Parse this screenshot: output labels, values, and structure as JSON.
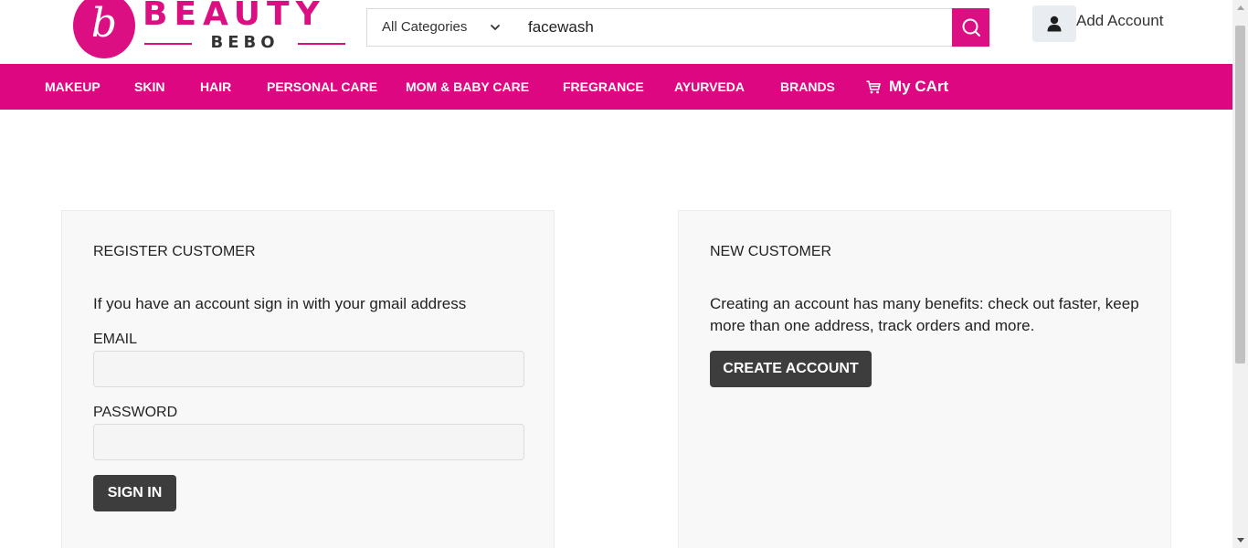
{
  "logo": {
    "initial": "b",
    "word": "BEAUTY",
    "sub": "BEBO"
  },
  "search": {
    "category": "All Categories",
    "query": "facewash"
  },
  "account": {
    "label": "Add Account"
  },
  "nav": {
    "items": [
      "MAKEUP",
      "SKIN",
      "HAIR",
      "PERSONAL CARE",
      "MOM & BABY CARE",
      "FREGRANCE",
      "AYURVEDA",
      "BRANDS"
    ],
    "cart_label": "My CArt"
  },
  "register": {
    "title": "REGISTER CUSTOMER",
    "text": "If you have an account sign in with your gmail address",
    "email_label": "EMAIL",
    "email_value": "",
    "password_label": "PASSWORD",
    "password_value": "",
    "sign_in_label": "SIGN IN"
  },
  "new_customer": {
    "title": "NEW CUSTOMER",
    "text": "Creating an account has many benefits: check out faster, keep more than one address, track orders and more.",
    "create_label": "CREATE ACCOUNT"
  },
  "colors": {
    "brand": "#dc0781",
    "button_dark": "#3d3d3d"
  }
}
